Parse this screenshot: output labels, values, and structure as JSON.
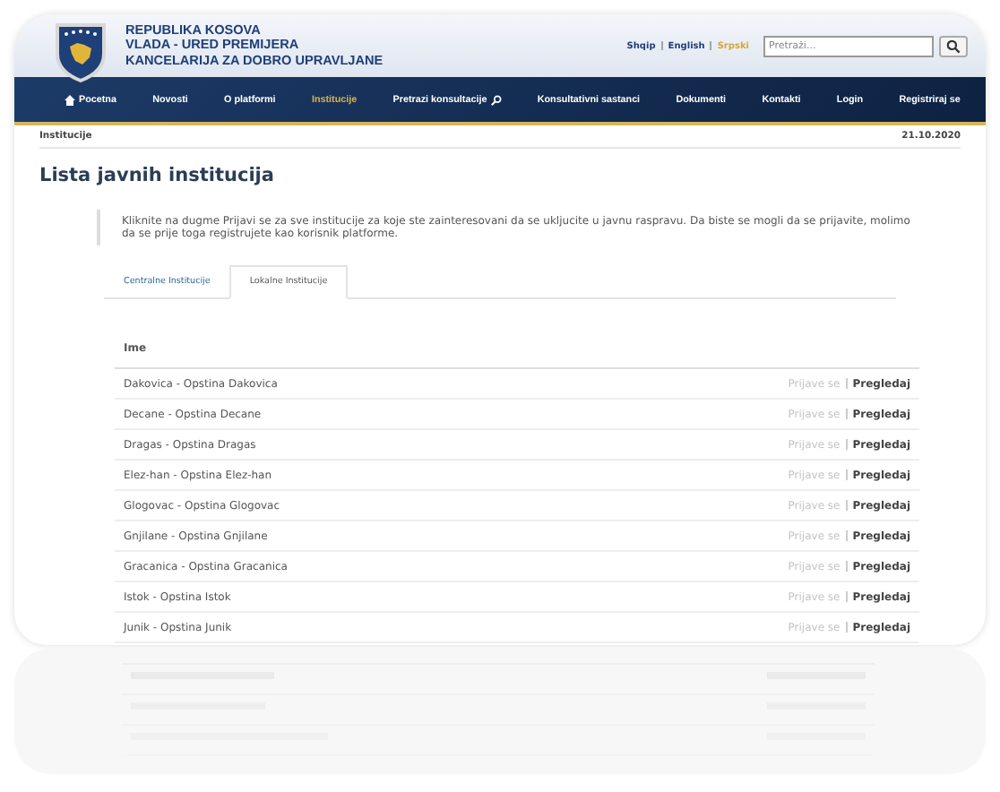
{
  "header": {
    "title_lines": [
      "REPUBLIKA KOSOVA",
      "VLADA - URED PREMIJERA",
      "KANCELARIJA ZA DOBRO UPRAVLJANE"
    ],
    "languages": [
      {
        "label": "Shqip",
        "selected": false
      },
      {
        "label": "English",
        "selected": false
      },
      {
        "label": "Srpski",
        "selected": true
      }
    ],
    "search": {
      "placeholder": "Pretraži..."
    }
  },
  "nav": [
    {
      "label": "Pocetna",
      "kind": "home",
      "selected": false
    },
    {
      "label": "Novosti",
      "kind": "link",
      "selected": false
    },
    {
      "label": "O platformi",
      "kind": "link",
      "selected": false
    },
    {
      "label": "Institucije",
      "kind": "link",
      "selected": true
    },
    {
      "label": "Pretrazi konsultacije",
      "kind": "search",
      "selected": false
    },
    {
      "label": "Konsultativni sastanci",
      "kind": "link",
      "selected": false
    },
    {
      "label": "Dokumenti",
      "kind": "link",
      "selected": false
    },
    {
      "label": "Kontakti",
      "kind": "link",
      "selected": false
    },
    {
      "label": "Login",
      "kind": "link",
      "selected": false
    },
    {
      "label": "Registriraj se",
      "kind": "link",
      "selected": false
    }
  ],
  "breadcrumb": "Institucije",
  "date": "21.10.2020",
  "page_title": "Lista javnih institucija",
  "note": "Kliknite na dugme Prijavi se za sve institucije za koje ste zainteresovani da se ukljucite u javnu raspravu. Da biste se mogli da se prijavite, molimo da se prije toga registrujete kao korisnik platforme.",
  "tabs": [
    {
      "label": "Centralne Institucije",
      "selected": false
    },
    {
      "label": "Lokalne Institucije",
      "selected": true
    }
  ],
  "table": {
    "columns": [
      "Ime"
    ],
    "rows": [
      {
        "name": "Dakovica - Opstina Dakovica",
        "register": "Prijave se",
        "register_disabled": true,
        "view": "Pregledaj"
      },
      {
        "name": "Decane - Opstina Decane",
        "register": "Prijave se",
        "register_disabled": true,
        "view": "Pregledaj"
      },
      {
        "name": "Dragas - Opstina Dragas",
        "register": "Prijave se",
        "register_disabled": true,
        "view": "Pregledaj"
      },
      {
        "name": "Elez-han - Opstina Elez-han",
        "register": "Prijave se",
        "register_disabled": true,
        "view": "Pregledaj"
      },
      {
        "name": "Glogovac - Opstina Glogovac",
        "register": "Prijave se",
        "register_disabled": true,
        "view": "Pregledaj"
      },
      {
        "name": "Gnjilane - Opstina Gnjilane",
        "register": "Prijave se",
        "register_disabled": true,
        "view": "Pregledaj"
      },
      {
        "name": "Gracanica - Opstina Gracanica",
        "register": "Prijave se",
        "register_disabled": true,
        "view": "Pregledaj"
      },
      {
        "name": "Istok - Opstina Istok",
        "register": "Prijave se",
        "register_disabled": true,
        "view": "Pregledaj"
      },
      {
        "name": "Junik - Opstina Junik",
        "register": "Prijave se",
        "register_disabled": true,
        "view": "Pregledaj"
      }
    ]
  }
}
